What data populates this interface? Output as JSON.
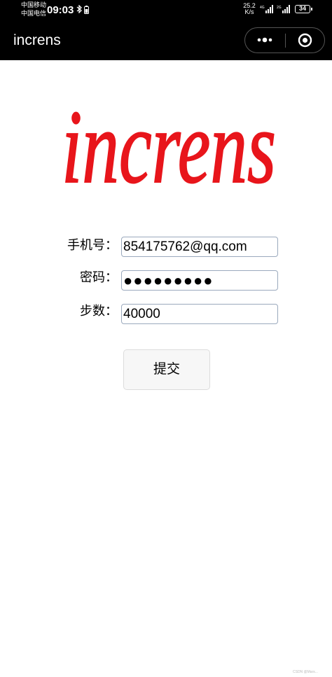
{
  "status_bar": {
    "carrier_1": "中国移动",
    "carrier_2": "中国电信",
    "time": "09:03",
    "net_speed_value": "25.2",
    "net_speed_unit": "K/s",
    "battery": "34"
  },
  "nav": {
    "title": "increns"
  },
  "logo_text": "increns",
  "form": {
    "phone_label": "手机号：",
    "phone_value": "854175762@qq.com",
    "password_label": "密码：",
    "password_value": "●●●●●●●●●",
    "steps_label": "步数：",
    "steps_value": "40000",
    "submit_label": "提交"
  },
  "colors": {
    "logo": "#e8151b",
    "field_border": "#9aa9bd",
    "status_bg": "#000000"
  },
  "watermark": "CSDN @Mars..."
}
